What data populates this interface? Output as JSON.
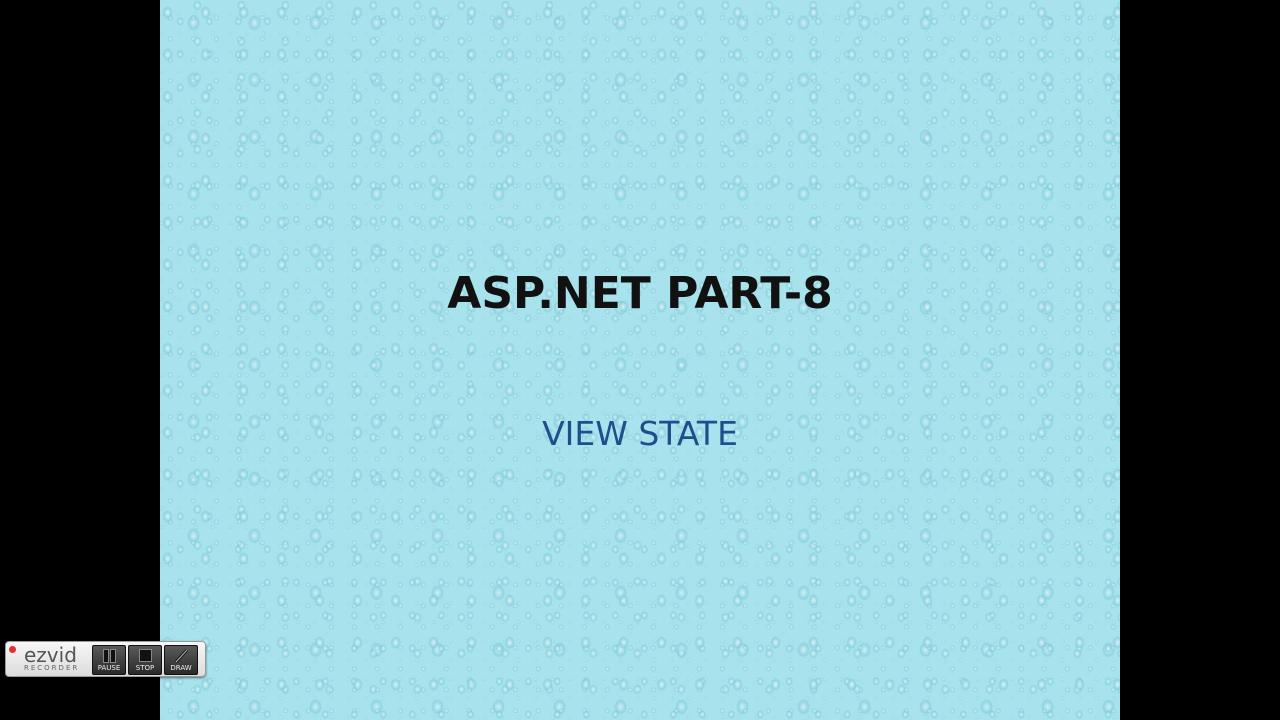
{
  "slide": {
    "title": "ASP.NET PART-8",
    "subtitle": "VIEW STATE"
  },
  "recorder": {
    "brand": "ezvid",
    "brand_sub": "RECORDER",
    "controls": {
      "pause_label": "PAUSE",
      "stop_label": "STOP",
      "draw_label": "DRAW"
    },
    "icons": {
      "record": "record-indicator-icon",
      "pause": "pause-icon",
      "stop": "stop-icon",
      "draw": "pen-icon"
    },
    "colors": {
      "record_dot": "#e03030"
    }
  },
  "colors": {
    "slide_background": "#a8e2ec",
    "title": "#111111",
    "subtitle": "#1f4e8c",
    "letterbox": "#000000"
  }
}
